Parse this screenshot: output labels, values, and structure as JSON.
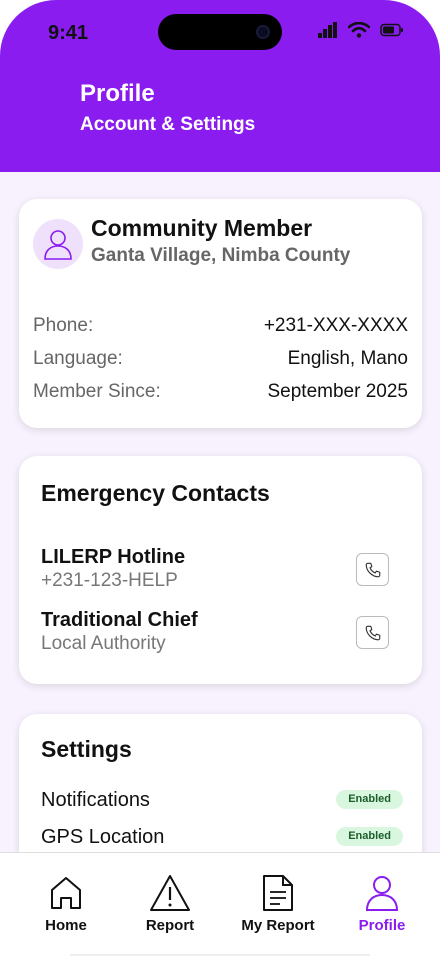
{
  "status_bar": {
    "time": "9:41"
  },
  "header": {
    "title": "Profile",
    "subtitle": "Account & Settings"
  },
  "profile": {
    "name": "Community Member",
    "location": "Ganta Village, Nimba County",
    "rows": [
      {
        "label": "Phone:",
        "value": "+231-XXX-XXXX"
      },
      {
        "label": "Language:",
        "value": "English, Mano"
      },
      {
        "label": "Member Since:",
        "value": "September 2025"
      }
    ]
  },
  "emergency": {
    "title": "Emergency Contacts",
    "contacts": [
      {
        "name": "LILERP Hotline",
        "detail": "+231-123-HELP"
      },
      {
        "name": "Traditional Chief",
        "detail": "Local Authority"
      }
    ]
  },
  "settings": {
    "title": "Settings",
    "items": [
      {
        "label": "Notifications",
        "status": "Enabled"
      },
      {
        "label": "GPS Location",
        "status": "Enabled"
      }
    ]
  },
  "nav": {
    "items": [
      {
        "label": "Home",
        "icon": "home-icon"
      },
      {
        "label": "Report",
        "icon": "warning-icon"
      },
      {
        "label": "My Report",
        "icon": "document-icon"
      },
      {
        "label": "Profile",
        "icon": "user-icon"
      }
    ],
    "active": "Profile"
  },
  "colors": {
    "accent": "#8a1cf0",
    "badge_bg": "#d9f6df",
    "badge_text": "#1a5e2a"
  }
}
